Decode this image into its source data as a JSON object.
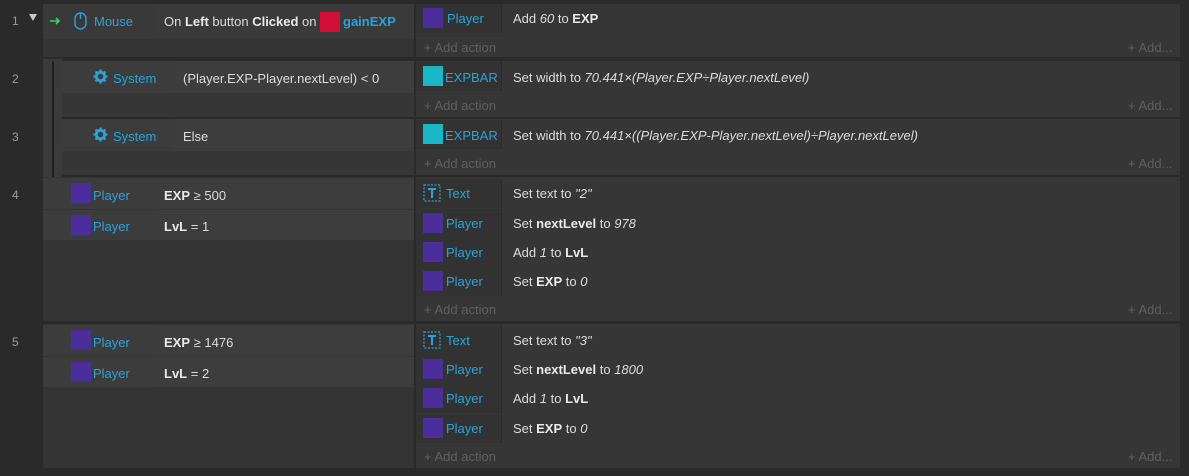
{
  "events": [
    {
      "num": "1",
      "cond_object": "Mouse",
      "cond_parts": [
        "On ",
        "Left",
        " button ",
        "Clicked",
        " on "
      ],
      "cond_target": "gainEXP",
      "actions": [
        {
          "object": "Player",
          "text": [
            "Add ",
            "60",
            " to ",
            "EXP"
          ]
        }
      ]
    },
    {
      "num": "2",
      "cond_object": "System",
      "cond_text": "(Player.EXP-Player.nextLevel) < 0",
      "actions": [
        {
          "object": "EXPBAR",
          "text": [
            "Set width to ",
            "70.441×(Player.EXP÷Player.nextLevel)"
          ]
        }
      ]
    },
    {
      "num": "3",
      "cond_object": "System",
      "cond_text": "Else",
      "actions": [
        {
          "object": "EXPBAR",
          "text": [
            "Set width to ",
            "70.441×((Player.EXP-Player.nextLevel)÷Player.nextLevel)"
          ]
        }
      ]
    },
    {
      "num": "4",
      "conditions": [
        {
          "object": "Player",
          "bold": "EXP",
          "rest": " ≥ 500"
        },
        {
          "object": "Player",
          "bold": "LvL",
          "rest": " = 1"
        }
      ],
      "actions": [
        {
          "object": "Text",
          "parts": [
            "Set text to ",
            "\"2\""
          ]
        },
        {
          "object": "Player",
          "parts": [
            "Set ",
            "nextLevel",
            " to ",
            "978"
          ]
        },
        {
          "object": "Player",
          "parts": [
            "Add ",
            "1",
            " to ",
            "LvL"
          ]
        },
        {
          "object": "Player",
          "parts": [
            "Set ",
            "EXP",
            " to ",
            "0"
          ]
        }
      ]
    },
    {
      "num": "5",
      "conditions": [
        {
          "object": "Player",
          "bold": "EXP",
          "rest": " ≥ 1476"
        },
        {
          "object": "Player",
          "bold": "LvL",
          "rest": " = 2"
        }
      ],
      "actions": [
        {
          "object": "Text",
          "parts": [
            "Set text to ",
            "\"3\""
          ]
        },
        {
          "object": "Player",
          "parts": [
            "Set ",
            "nextLevel",
            " to ",
            "1800"
          ]
        },
        {
          "object": "Player",
          "parts": [
            "Add ",
            "1",
            " to ",
            "LvL"
          ]
        },
        {
          "object": "Player",
          "parts": [
            "Set ",
            "EXP",
            " to ",
            "0"
          ]
        }
      ]
    }
  ],
  "labels": {
    "add_action": "+ Add action",
    "add": "+ Add..."
  },
  "colors": {
    "object_name": "#2aa3d8",
    "player_icon": "#4a2e9c",
    "expbar_icon": "#1ab7c4",
    "gainexp_icon": "#d01037",
    "trigger_arrow": "#3fcf5a"
  },
  "icons": {
    "mouse": "mouse-icon",
    "system": "gear-icon",
    "text": "text-object-icon",
    "trigger": "trigger-arrow-icon",
    "collapse": "collapse-triangle-icon"
  }
}
